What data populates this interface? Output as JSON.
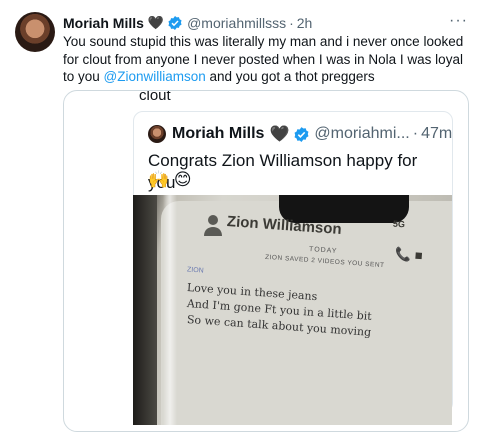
{
  "tweet": {
    "name": "Moriah Mills",
    "heart": "🖤",
    "handle": "@moriahmillsss",
    "time": "2h",
    "more": "···",
    "text_before": "You sound stupid this was literally my man and i never once looked for clout from anyone I never posted when I was in Nola I was loyal to you ",
    "mention": "@Zionwilliamson",
    "text_after": " and you got a thot preggers"
  },
  "quote": {
    "top_text": "clout",
    "name": "Moriah Mills",
    "heart": "🖤",
    "handle": "@moriahmi...",
    "time": "47m",
    "text": "Congrats Zion Williamson happy for you",
    "emojis": "🙌 😊"
  },
  "photo": {
    "contact_name": "Zion Williamson",
    "status": "5G",
    "call_icons": "📞 ■",
    "today": "TODAY",
    "saved": "ZION SAVED 2 VIDEOS YOU SENT",
    "sender": "ZION",
    "messages": [
      "Love you in these jeans",
      "And I'm gone Ft you in a little bit",
      "So we can talk about you moving"
    ]
  },
  "colors": {
    "link": "#1d9bf0",
    "verified": "#1d9bf0",
    "muted": "#536471"
  }
}
